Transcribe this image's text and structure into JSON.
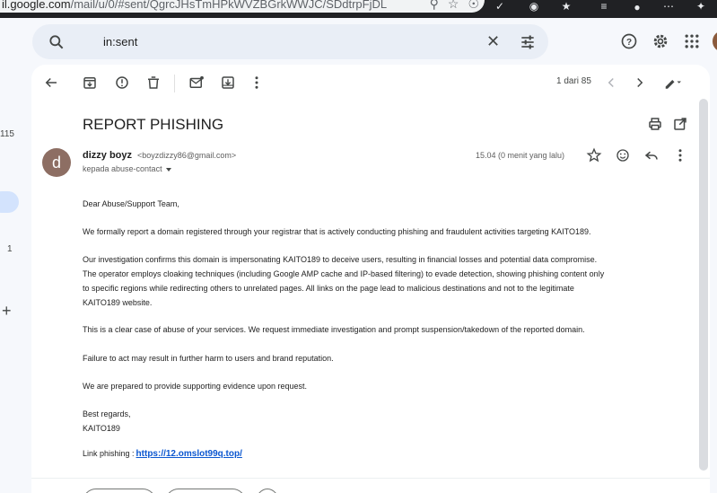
{
  "browser": {
    "url_host": "il.google.com",
    "url_path": "/mail/u/0/#sent/QgrcJHsTmHPkWVZBGrkWWJC/SDdtrpFjDL"
  },
  "search": {
    "query": "in:sent"
  },
  "left_rail": {
    "count_top": "115",
    "count_mid": "1"
  },
  "toolbar": {
    "page_count": "1 dari 85"
  },
  "email": {
    "subject": "REPORT PHISHING",
    "sender_initial": "d",
    "sender_name": "dizzy boyz",
    "sender_email": "<boyzdizzy86@gmail.com>",
    "recipient": "kepada abuse-contact",
    "timestamp": "15.04 (0 menit yang lalu)",
    "greeting": "Dear Abuse/Support Team,",
    "para1": "We formally report a domain registered through your registrar that is actively conducting phishing and fraudulent activities targeting KAITO189.",
    "para2_line1": "Our investigation confirms this domain is impersonating KAITO189 to deceive users, resulting in financial losses and potential data compromise.",
    "para2_line2": "The operator employs cloaking techniques (including Google AMP cache and IP-based filtering) to evade detection, showing phishing content only",
    "para2_line3": "to specific regions while redirecting others to unrelated pages. All links on the page lead to malicious destinations and not to the legitimate",
    "para2_line4": "KAITO189  website.",
    "para3": "This is a clear case of abuse of your services. We request immediate investigation and prompt suspension/takedown of the reported domain.",
    "para4": "Failure to act may result in further harm to users and brand reputation.",
    "para5": "We are prepared to provide supporting evidence upon request.",
    "closing": "Best regards,",
    "signature": "KAITO189",
    "link_label": "Link phishing :",
    "link_url": "https://12.omslot99q.top/"
  },
  "colors": {
    "accent": "#0b57d0",
    "sender_avatar": "#8d6e63",
    "search_bg": "#e9eef6"
  }
}
